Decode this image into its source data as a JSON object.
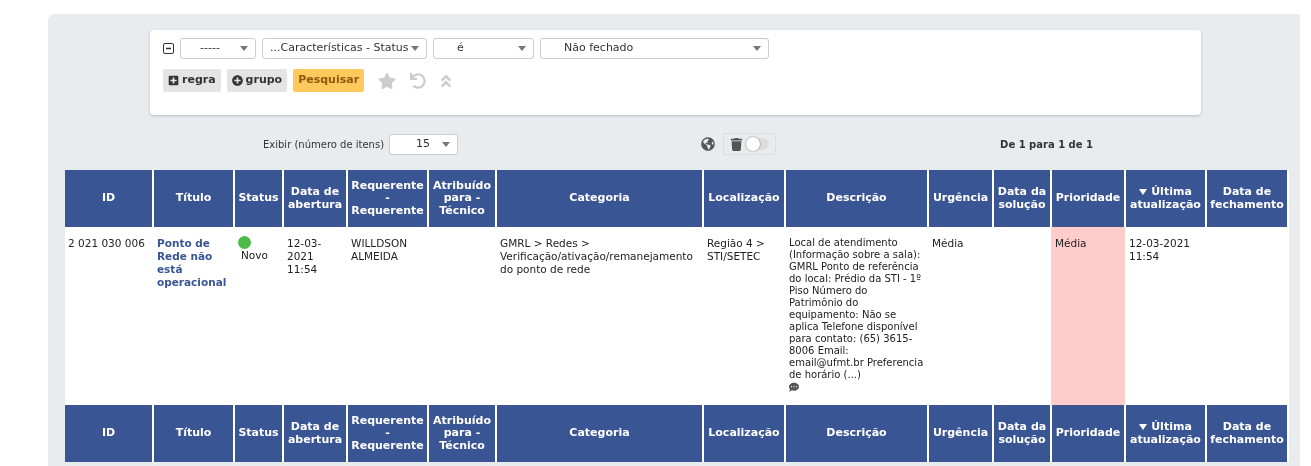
{
  "filter": {
    "selects": [
      {
        "value": "-----"
      },
      {
        "value": "...Características - Status"
      },
      {
        "value": "é"
      },
      {
        "value": "Não fechado"
      }
    ],
    "buttons": [
      {
        "label": "regra",
        "kind": "add"
      },
      {
        "label": "grupo",
        "kind": "group"
      },
      {
        "label": "Pesquisar",
        "kind": "search"
      }
    ]
  },
  "toolbar": {
    "display_label": "Exibir (número de itens)",
    "display_value": "15",
    "toggle": {
      "on": false
    },
    "pagination": "De 1 para 1 de 1"
  },
  "table": {
    "columns": [
      {
        "label": "ID",
        "sorted": false
      },
      {
        "label": "Título",
        "sorted": false
      },
      {
        "label": "Status",
        "sorted": false
      },
      {
        "label": "Data de abertura",
        "sorted": false
      },
      {
        "label": "Requerente - Requerente",
        "sorted": false
      },
      {
        "label": "Atribuído para - Técnico",
        "sorted": false
      },
      {
        "label": "Categoria",
        "sorted": false
      },
      {
        "label": "Localização",
        "sorted": false
      },
      {
        "label": "Descrição",
        "sorted": false
      },
      {
        "label": "Urgência",
        "sorted": false
      },
      {
        "label": "Data da solução",
        "sorted": false
      },
      {
        "label": "Prioridade",
        "sorted": false
      },
      {
        "label": "Última atualização",
        "sorted": true
      },
      {
        "label": "Data de fechamento",
        "sorted": false
      }
    ],
    "rows": [
      {
        "id": "2 021 030 006",
        "title": "Ponto de Rede não está operacional",
        "status": {
          "label": "Novo",
          "color": "#4cbb47"
        },
        "opened": "12-03-2021 11:54",
        "requester": "WILLDSON ALMEIDA",
        "category": "GMRL > Redes > Verificação/ativação/remanejamento do ponto de rede",
        "location": "Região 4 > STI/SETEC",
        "description": "Local de atendimento (Informação sobre a sala): GMRL Ponto de referência do local: Prédio da STI - 1º Piso Número do Patrimônio do equipamento: Não se aplica Telefone disponível para contato: (65) 3615-8006 Email: email@ufmt.br Preferencia de horário (...)",
        "urgency": "Média",
        "priority": {
          "label": "Média",
          "color": "#ffcccc"
        },
        "updated": "12-03-2021 11:54"
      }
    ],
    "footer_columns": [
      {
        "label": "ID",
        "sorted": false
      },
      {
        "label": "Título",
        "sorted": false
      },
      {
        "label": "Status",
        "sorted": false
      },
      {
        "label": "Data de abertura",
        "sorted": false
      },
      {
        "label": "Requerente - Requerente",
        "sorted": false
      },
      {
        "label": "Atribuído para - Técnico",
        "sorted": false
      },
      {
        "label": "Categoria",
        "sorted": false
      },
      {
        "label": "Localização",
        "sorted": false
      },
      {
        "label": "Descrição",
        "sorted": false
      },
      {
        "label": "Urgência",
        "sorted": false
      },
      {
        "label": "Data da solução",
        "sorted": false
      },
      {
        "label": "Prioridade",
        "sorted": false
      },
      {
        "label": "Última atualização",
        "sorted": true
      },
      {
        "label": "Data de fechamento",
        "sorted": false
      }
    ]
  }
}
